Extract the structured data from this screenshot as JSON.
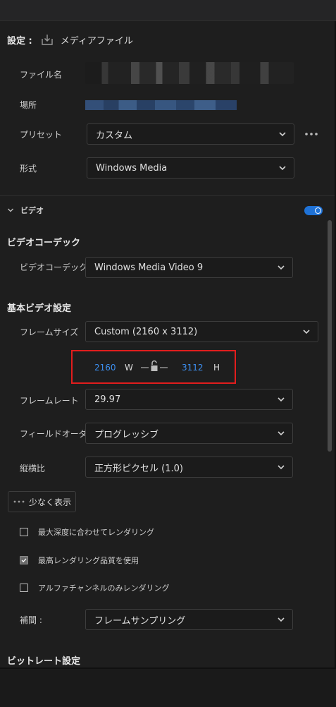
{
  "header": {
    "settings_label": "設定 :",
    "output_type": "メディアファイル",
    "icon": "export-icon"
  },
  "file": {
    "name_label": "ファイル名",
    "location_label": "場所",
    "preset_label": "プリセット",
    "preset_value": "カスタム",
    "format_label": "形式",
    "format_value": "Windows Media"
  },
  "video": {
    "section_label": "ビデオ",
    "enabled": true,
    "codec_title": "ビデオコーデック",
    "codec_label": "ビデオコーデック",
    "codec_value": "Windows Media Video 9",
    "basic_title": "基本ビデオ設定",
    "frame_size_label": "フレームサイズ",
    "frame_size_value": "Custom (2160 x 3112)",
    "width": "2160",
    "width_unit": "W",
    "height": "3112",
    "height_unit": "H",
    "frame_rate_label": "フレームレート",
    "frame_rate_value": "29.97",
    "field_order_label": "フィールドオーダー",
    "field_order_value": "プログレッシブ",
    "aspect_label": "縦横比",
    "aspect_value": "正方形ピクセル (1.0)",
    "show_less_label": "少なく表示",
    "options": [
      {
        "label": "最大深度に合わせてレンダリング",
        "checked": false
      },
      {
        "label": "最高レンダリング品質を使用",
        "checked": true
      },
      {
        "label": "アルファチャンネルのみレンダリング",
        "checked": false
      }
    ],
    "interpolation_label": "補間 :",
    "interpolation_value": "フレームサンプリング",
    "bitrate_title": "ビットレート設定"
  },
  "colors": {
    "accent": "#1f72d6",
    "link_value": "#3d8ff0",
    "highlight_box": "#e21d1d",
    "background": "#1e1e1e"
  }
}
